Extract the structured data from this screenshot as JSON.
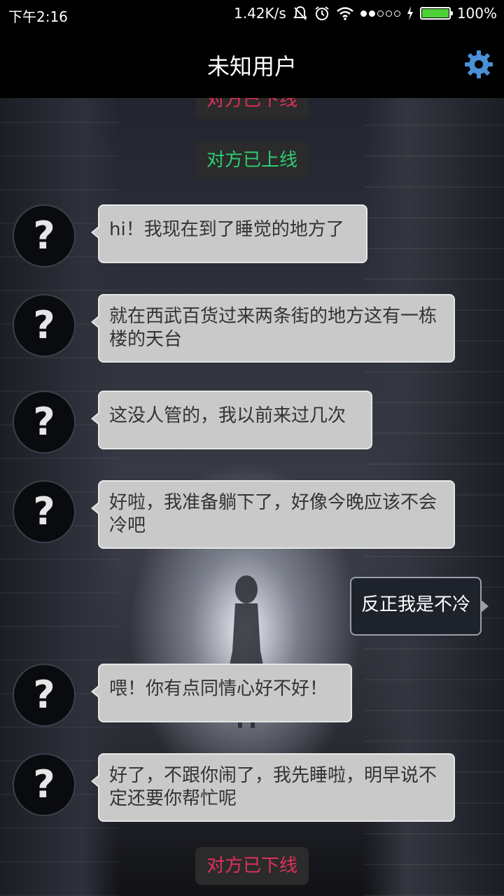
{
  "status_bar": {
    "time": "下午2:16",
    "speed": "1.42K/s",
    "battery": "100%",
    "battery_level": 1.0
  },
  "app_bar": {
    "title": "未知用户",
    "settings_icon": "gear-icon"
  },
  "messages": {
    "sys_top": "对方已下线",
    "sys_online": "对方已上线",
    "m1": "hi！我现在到了睡觉的地方了",
    "m2": "就在西武百货过来两条街的地方这有一栋楼的天台",
    "m3": "这没人管的，我以前来过几次",
    "m4": "好啦，我准备躺下了，好像今晚应该不会冷吧",
    "m5_out": "反正我是不冷",
    "m6": "喂！你有点同情心好不好！",
    "m7": "好了，不跟你闹了，我先睡啦，明早说不定还要你帮忙呢",
    "sys_bottom": "对方已下线",
    "avatar_glyph": "?"
  },
  "colors": {
    "online": "#2ecc71",
    "offline": "#e0305a",
    "gear": "#4a90d9"
  }
}
